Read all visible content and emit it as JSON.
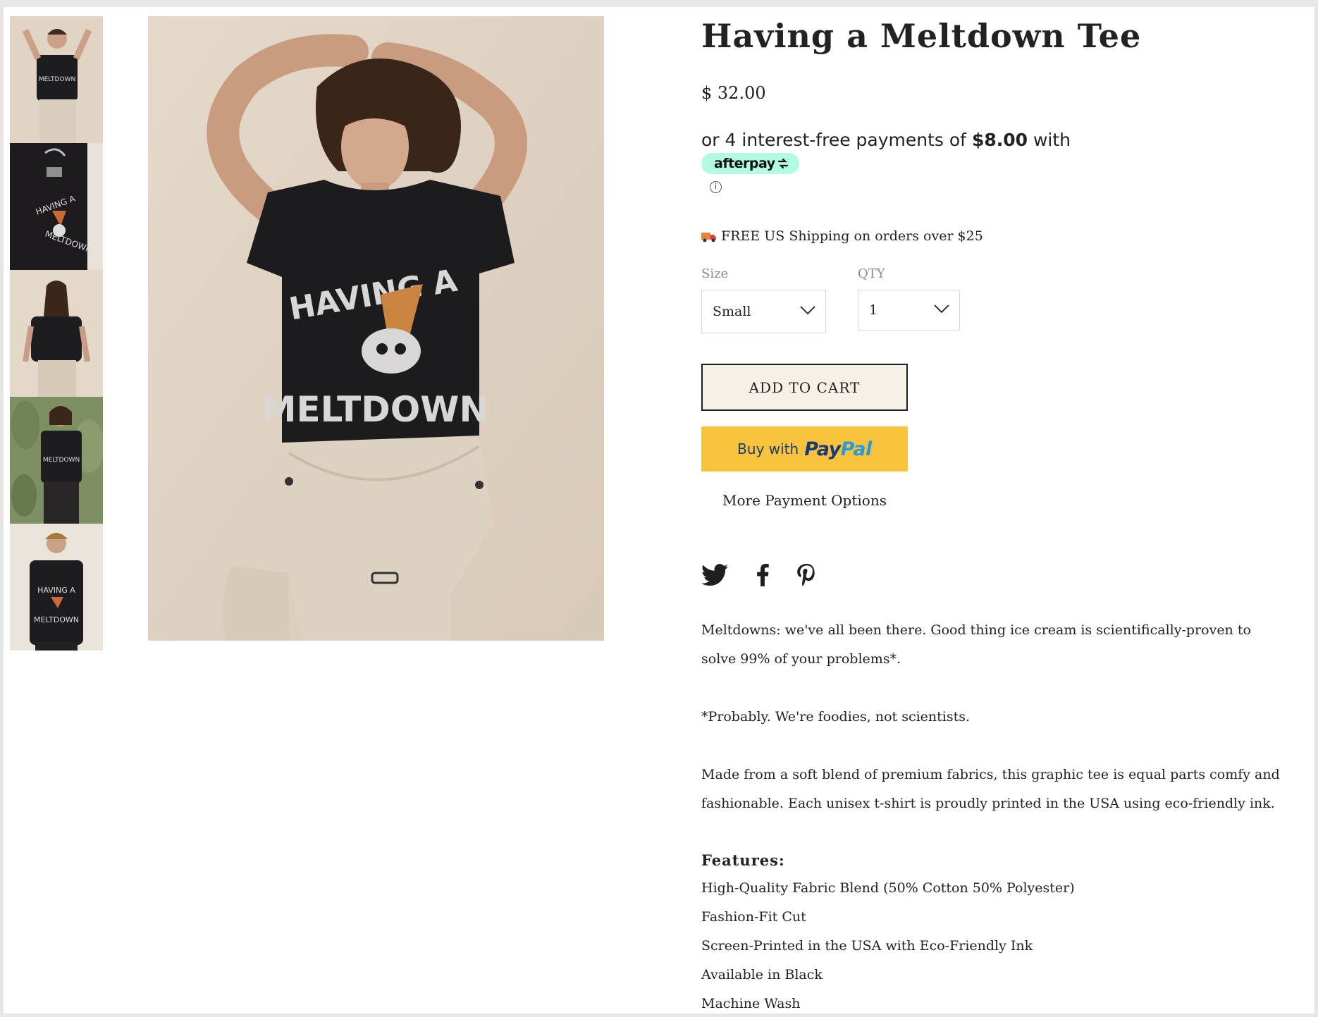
{
  "product": {
    "title": "Having a Meltdown Tee",
    "price": "$ 32.00"
  },
  "afterpay": {
    "prefix": "or 4 interest-free payments of ",
    "amount": "$8.00",
    "suffix": " with",
    "badge": "afterpay",
    "info_icon": "info-icon"
  },
  "shipping": {
    "icon": "truck-icon",
    "text": "FREE US Shipping on orders over $25"
  },
  "options": {
    "size_label": "Size",
    "size_value": "Small",
    "qty_label": "QTY",
    "qty_value": "1"
  },
  "buttons": {
    "add_to_cart": "ADD TO CART",
    "paypal_prefix": "Buy with",
    "paypal_pay": "Pay",
    "paypal_pal": "Pal",
    "more_payment": "More Payment Options"
  },
  "social": [
    "twitter-icon",
    "facebook-icon",
    "pinterest-icon"
  ],
  "description": {
    "p1": "Meltdowns: we've all been there. Good thing ice cream is scientifically-proven to solve 99% of your problems*.",
    "p2": "*Probably. We're foodies, not scientists.",
    "p3": "Made from a soft blend of premium fabrics, this graphic tee is equal parts comfy and fashionable. Each unisex t-shirt is proudly printed in the USA using eco-friendly ink."
  },
  "features": {
    "title": "Features:",
    "items": [
      "High-Quality Fabric Blend (50% Cotton 50% Polyester)",
      "Fashion-Fit Cut",
      "Screen-Printed in the USA with Eco-Friendly Ink",
      "Available in Black",
      "Machine Wash"
    ]
  },
  "gallery": {
    "thumbnail_count": 5,
    "shirt_print_line1": "HAVING A",
    "shirt_print_line2": "MELTDOWN"
  },
  "colors": {
    "shirt": "#1c1b1d",
    "backdrop": "#e3d6c8",
    "pants": "#ddd2c2",
    "afterpay_mint": "#b2fce4",
    "paypal_yellow": "#f7c33f",
    "cart_bg": "#f5f1e6"
  }
}
